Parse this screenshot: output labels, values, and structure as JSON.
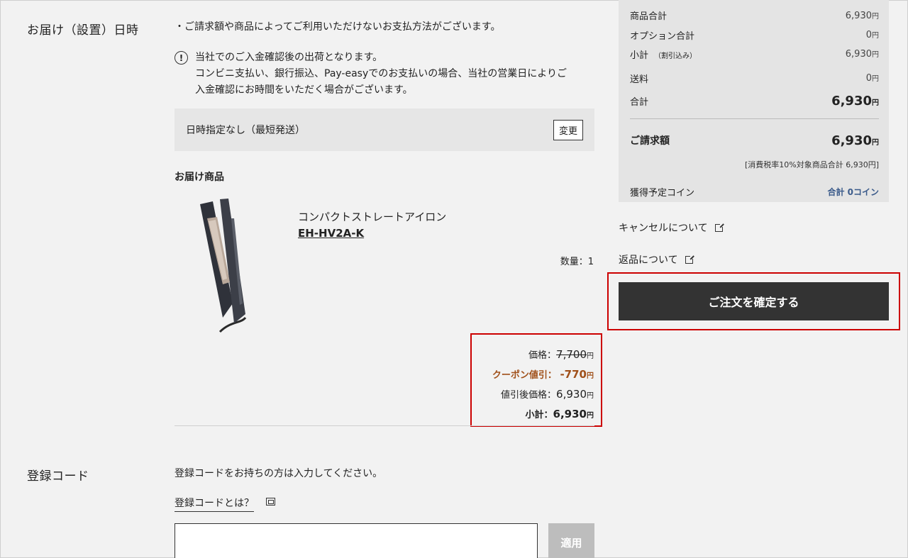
{
  "delivery": {
    "section_label": "お届け（設置）日時",
    "payment_note": "・ご請求額や商品によってご利用いただけないお支払方法がございます。",
    "info_line1": "当社でのご入金確認後の出荷となります。",
    "info_line2": "コンビニ支払い、銀行振込、Pay-easyでのお支払いの場合、当社の営業日によりご",
    "info_line3": "入金確認にお時間をいただく場合がございます。",
    "date_text": "日時指定なし（最短発送）",
    "change_label": "変更"
  },
  "items": {
    "title": "お届け商品",
    "product_name": "コンパクトストレートアイロン",
    "product_code": "EH-HV2A-K",
    "quantity": "数量：1",
    "price_label": "価格：",
    "price_value": "7,700",
    "coupon_label": "クーポン値引：",
    "coupon_value": "-770",
    "discounted_label": "値引後価格：",
    "discounted_value": "6,930",
    "subtotal_label": "小計：",
    "subtotal_value": "6,930",
    "yen": "円"
  },
  "registration": {
    "section_label": "登録コード",
    "description": "登録コードをお持ちの方は入力してください。",
    "help_link": "登録コードとは？",
    "apply_label": "適用"
  },
  "summary": {
    "product_total_label": "商品合計",
    "product_total_value": "6,930",
    "option_total_label": "オプション合計",
    "option_total_value": "0",
    "subtotal_label": "小計",
    "subtotal_note": "（割引込み）",
    "subtotal_value": "6,930",
    "shipping_label": "送料",
    "shipping_value": "0",
    "total_label": "合計",
    "total_value": "6,930",
    "billing_label": "ご請求額",
    "billing_value": "6,930",
    "tax_note": "[消費税率10%対象商品合計 6,930円]",
    "coin_label": "獲得予定コイン",
    "coin_value": "合計 0コイン",
    "yen": "円"
  },
  "links": {
    "cancel": "キャンセルについて",
    "returns": "返品について"
  },
  "confirm_label": "ご注文を確定する"
}
